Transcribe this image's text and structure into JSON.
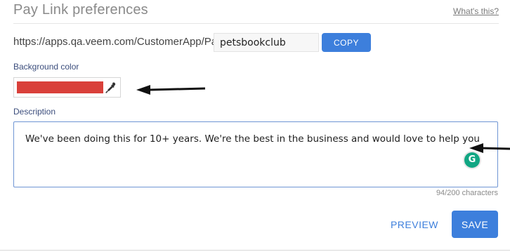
{
  "header": {
    "title": "Pay Link preferences",
    "help_link": "What's this?"
  },
  "paylink": {
    "url_prefix": "https://apps.qa.veem.com/CustomerApp/Pay/",
    "slug_value": "petsbookclub",
    "copy_label": "COPY"
  },
  "background": {
    "label": "Background color",
    "color": "#d9403a"
  },
  "description": {
    "label": "Description",
    "value": "We've been doing this for 10+ years. We're the best in the business and would love to help you",
    "char_count": "94/200 characters"
  },
  "actions": {
    "preview_label": "PREVIEW",
    "save_label": "SAVE"
  },
  "colors": {
    "accent": "#3d7fdc",
    "label_text": "#3b4d7c",
    "grammarly": "#11a683"
  },
  "icons": {
    "eyedropper": "eyedropper-icon",
    "grammarly": "grammarly-icon"
  }
}
